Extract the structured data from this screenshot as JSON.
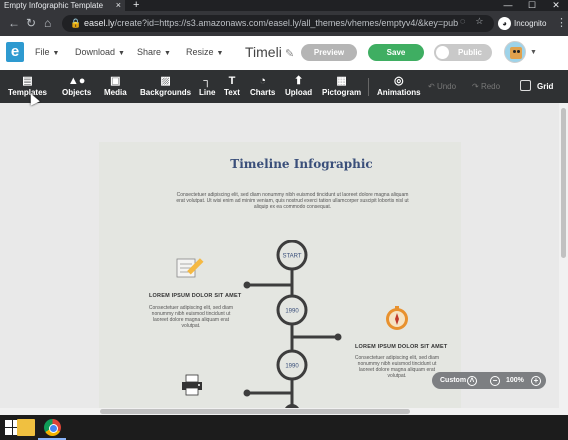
{
  "browser": {
    "tab_title": "Empty Infographic Template",
    "tab_close": "×",
    "new_tab": "+",
    "url_host": "easel.ly",
    "url_path": "/create?id=https://s3.amazonaws.com/easel.ly/all_themes/vhemes/emptyv4/&key=pub",
    "incognito_label": "Incognito",
    "window_controls": [
      "—",
      "☐",
      "✕"
    ]
  },
  "app": {
    "logo": "e",
    "menus": [
      {
        "label": "File"
      },
      {
        "label": "Download"
      },
      {
        "label": "Share"
      },
      {
        "label": "Resize"
      }
    ],
    "document_title": "Timeli",
    "preview_label": "Preview",
    "save_label": "Save",
    "public_label": "Public"
  },
  "toolbar": {
    "tools": [
      {
        "label": "Templates",
        "icon": "templates-icon"
      },
      {
        "label": "Objects",
        "icon": "objects-icon"
      },
      {
        "label": "Media",
        "icon": "media-icon"
      },
      {
        "label": "Backgrounds",
        "icon": "backgrounds-icon"
      },
      {
        "label": "Line",
        "icon": "line-icon"
      },
      {
        "label": "Text",
        "icon": "text-icon"
      },
      {
        "label": "Charts",
        "icon": "charts-icon"
      },
      {
        "label": "Upload",
        "icon": "upload-icon"
      },
      {
        "label": "Pictogram",
        "icon": "pictogram-icon"
      },
      {
        "label": "Animations",
        "icon": "animations-icon"
      }
    ],
    "undo_label": "Undo",
    "redo_label": "Redo",
    "grid_label": "Grid"
  },
  "infographic": {
    "title": "Timeline Infographic",
    "intro": "Consectetuer adipiscing elit, sed diam nonummy nibh euismod tincidunt ut laoreet dolore magna aliquam erat volutpat. Ut wisi enim ad minim veniam, quis nostrud exerci tation ullamcorper suscipit lobortis nisl ut aliquip ex ea commodo consequat.",
    "milestones": [
      {
        "label": "START"
      },
      {
        "label": "1990",
        "heading": "LOREM IPSUM DOLOR SIT AMET",
        "text": "Consectetuer adipiscing elit, sed diam nonummy nibh euismod tincidunt ut laoreet dolore magna aliquam erat volutpat."
      },
      {
        "label": "1990",
        "heading": "LOREM IPSUM DOLOR SIT AMET",
        "text": "Consectetuer adipiscing elit, sed diam nonummy nibh euismod tincidunt ut laoreet dolore magna aliquam erat volutpat."
      }
    ]
  },
  "zoom": {
    "mode": "Custom",
    "value": "100%"
  },
  "colors": {
    "accent_blue": "#2e9ad0",
    "save_green": "#3fae62",
    "toolbar_bg": "#2f3133",
    "title_blue": "#3a4f7a",
    "timeline_dark": "#3d3d3d"
  }
}
